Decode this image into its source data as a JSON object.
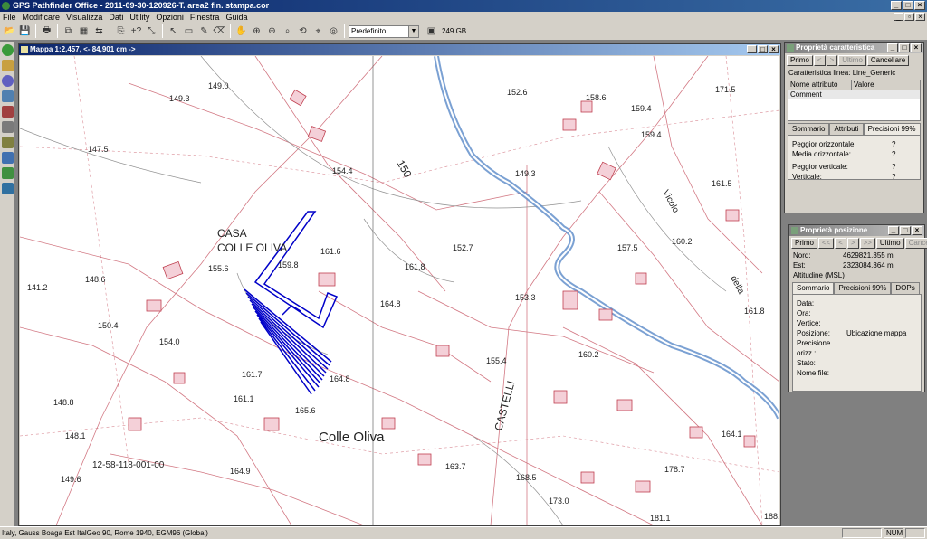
{
  "app": {
    "title": "GPS Pathfinder Office - 2011-09-30-120926-T. area2 fin. stampa.cor"
  },
  "menu": [
    "File",
    "Modificare",
    "Visualizza",
    "Dati",
    "Utility",
    "Opzioni",
    "Finestra",
    "Guida"
  ],
  "toolbar": {
    "layer_combo": "Predefinito",
    "disk_space": "249 GB",
    "help_label": "+?"
  },
  "map_window": {
    "title": "Mappa 1:2,457, <- 84,901 cm ->"
  },
  "map_labels": {
    "elevations": [
      "149.0",
      "149.3",
      "147.5",
      "148.6",
      "141.2",
      "150.4",
      "154.0",
      "155.6",
      "159.8",
      "161.6",
      "154.4",
      "152.7",
      "161.8",
      "164.8",
      "153.3",
      "155.4",
      "161.7",
      "161.1",
      "165.6",
      "164.8",
      "148.8",
      "148.1",
      "149.6",
      "164.9",
      "163.7",
      "168.5",
      "173.0",
      "178.7",
      "152.6",
      "158.6",
      "159.4",
      "159.4",
      "171.5",
      "161.5",
      "157.5",
      "160.2",
      "161.8",
      "164.1",
      "160.2",
      "149.3",
      "181.1",
      "188."
    ],
    "street_150": "150",
    "place_casa": "CASA",
    "place_colle_oliva_caps": "COLLE OLIVA",
    "place_colle_oliva": "Colle Oliva",
    "street_castelli": "CASTELLI",
    "street_vicolo": "Vicolo",
    "street_della": "della",
    "parcel_code": "12-58-118-001-00"
  },
  "feature_panel": {
    "title": "Proprietà caratteristica",
    "nav": {
      "first": "Primo",
      "prev": "<",
      "next": ">",
      "last": "Ultimo",
      "cancel": "Cancellare"
    },
    "feature_line": "Caratteristica linea: Line_Generic",
    "table_headers": [
      "Nome attributo",
      "Valore"
    ],
    "table_rows": [
      [
        "Comment",
        ""
      ]
    ],
    "tabs": [
      "Sommario",
      "Attributi",
      "Precisioni 99%"
    ],
    "rows": [
      [
        "Peggior orizzontale:",
        "?"
      ],
      [
        "Media orizzontale:",
        "?"
      ],
      [
        "Peggior verticale:",
        "?"
      ],
      [
        "Verticale:",
        "?"
      ]
    ]
  },
  "position_panel": {
    "title": "Proprietà posizione",
    "nav": {
      "first": "Primo",
      "prev2": "<<",
      "prev": "<",
      "next": ">",
      "next2": ">>",
      "last": "Ultimo",
      "cancel": "Cancellare"
    },
    "coords": [
      [
        "Nord:",
        "4629821.355 m"
      ],
      [
        "Est:",
        "2323084.364 m"
      ],
      [
        "Altitudine (MSL)",
        ""
      ]
    ],
    "tabs": [
      "Sommario",
      "Precisioni 99%",
      "DOPs"
    ],
    "rows": [
      [
        "Data:",
        ""
      ],
      [
        "Ora:",
        ""
      ],
      [
        "Vertice:",
        ""
      ],
      [
        "Posizione:",
        "Ubicazione mappa"
      ],
      [
        "Precisione orizz.:",
        ""
      ],
      [
        "Stato:",
        ""
      ],
      [
        "",
        ""
      ],
      [
        "Nome file:",
        ""
      ]
    ]
  },
  "statusbar": {
    "text": "Italy, Gauss Boaga Est ItalGeo 90, Rome 1940, EGM96 (Global)",
    "num": "NUM"
  },
  "colors": {
    "titlebar": "#0a246a",
    "map_line": "#c04050",
    "survey_blue": "#0000c8",
    "river": "#5a8ac8"
  }
}
